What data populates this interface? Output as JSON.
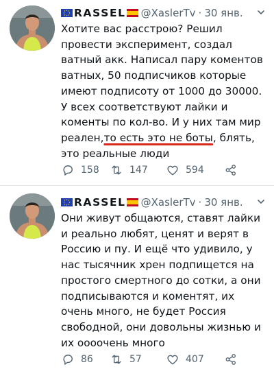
{
  "tweets": [
    {
      "author_name": "RASSEL",
      "handle": "@XaslerTv",
      "separator": "·",
      "date": "30 янв.",
      "text_before": "Хотите вас расстрою? Решил провести эксперимент, создал ватный акк. Написал пару коментов ватных, 50 подписчиков которые имеют подписоту от 1000 до 30000. У всех соответствуют лайки и коменты по кол-во. И у них там мир реален,",
      "text_underlined": "то есть это не боты",
      "text_after": ", блять, это реальные люди",
      "reply_count": "158",
      "retweet_count": "147",
      "like_count": "594"
    },
    {
      "author_name": "RASSEL",
      "handle": "@XaslerTv",
      "separator": "·",
      "date": "30 янв.",
      "text": "Они живут общаются, ставят лайки и реально любят, ценят и верят в Россию и пу. И ещё что удивило, у нас тысячник хрен подпищется на простого смертного до сотки, а они подписываются и коментят, их очень много, не будет Россия свободной, они довольны жизнью и их оооочень много",
      "reply_count": "86",
      "retweet_count": "57",
      "like_count": "407"
    }
  ],
  "icons": [
    "eu-flag-icon",
    "spain-flag-icon",
    "more-caret-icon",
    "reply-icon",
    "retweet-icon",
    "like-icon",
    "share-icon"
  ],
  "colors": {
    "text": "#0f1419",
    "muted": "#536471",
    "underline": "#d9261c"
  }
}
